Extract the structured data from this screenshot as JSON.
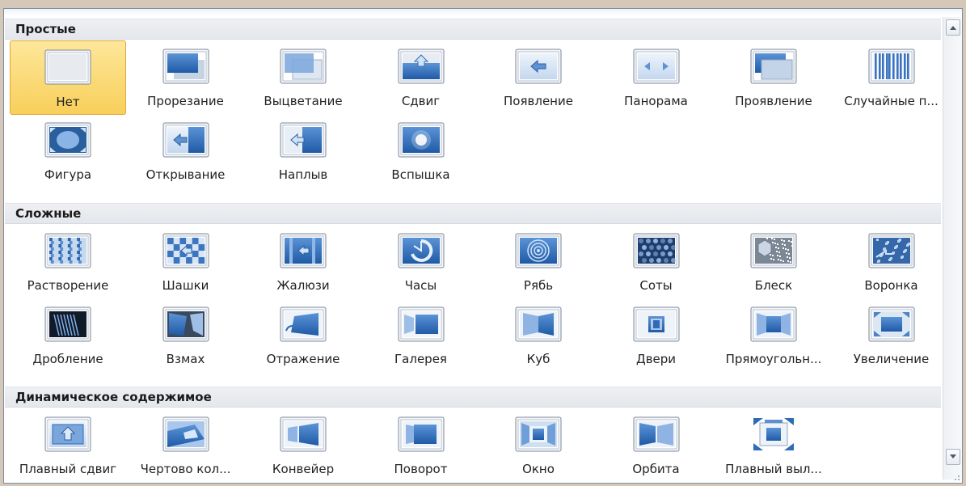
{
  "sections": [
    {
      "title": "Простые",
      "items": [
        {
          "label": "Нет",
          "icon": "none-icon",
          "selected": true
        },
        {
          "label": "Прорезание",
          "icon": "cut-icon"
        },
        {
          "label": "Выцветание",
          "icon": "fade-icon"
        },
        {
          "label": "Сдвиг",
          "icon": "push-icon"
        },
        {
          "label": "Появление",
          "icon": "wipe-icon"
        },
        {
          "label": "Панорама",
          "icon": "split-icon"
        },
        {
          "label": "Проявление",
          "icon": "reveal-icon"
        },
        {
          "label": "Случайные п...",
          "icon": "random-bars-icon"
        },
        {
          "label": "Фигура",
          "icon": "shape-icon"
        },
        {
          "label": "Открывание",
          "icon": "uncover-icon"
        },
        {
          "label": "Наплыв",
          "icon": "cover-icon"
        },
        {
          "label": "Вспышка",
          "icon": "flash-icon"
        }
      ]
    },
    {
      "title": "Сложные",
      "items": [
        {
          "label": "Растворение",
          "icon": "dissolve-icon"
        },
        {
          "label": "Шашки",
          "icon": "checkerboard-icon"
        },
        {
          "label": "Жалюзи",
          "icon": "blinds-icon"
        },
        {
          "label": "Часы",
          "icon": "clock-icon"
        },
        {
          "label": "Рябь",
          "icon": "ripple-icon"
        },
        {
          "label": "Соты",
          "icon": "honeycomb-icon"
        },
        {
          "label": "Блеск",
          "icon": "glitter-icon"
        },
        {
          "label": "Воронка",
          "icon": "vortex-icon"
        },
        {
          "label": "Дробление",
          "icon": "shred-icon"
        },
        {
          "label": "Взмах",
          "icon": "switch-icon"
        },
        {
          "label": "Отражение",
          "icon": "flip-icon"
        },
        {
          "label": "Галерея",
          "icon": "gallery-icon"
        },
        {
          "label": "Куб",
          "icon": "cube-icon"
        },
        {
          "label": "Двери",
          "icon": "doors-icon"
        },
        {
          "label": "Прямоугольн...",
          "icon": "box-icon"
        },
        {
          "label": "Увеличение",
          "icon": "zoom-icon"
        }
      ]
    },
    {
      "title": "Динамическое содержимое",
      "items": [
        {
          "label": "Плавный сдвиг",
          "icon": "pan-icon"
        },
        {
          "label": "Чертово кол...",
          "icon": "ferris-wheel-icon"
        },
        {
          "label": "Конвейер",
          "icon": "conveyor-icon"
        },
        {
          "label": "Поворот",
          "icon": "rotate-icon"
        },
        {
          "label": "Окно",
          "icon": "window-icon"
        },
        {
          "label": "Орбита",
          "icon": "orbit-icon"
        },
        {
          "label": "Плавный выл...",
          "icon": "fly-through-icon"
        }
      ]
    }
  ],
  "colors": {
    "selected_fill": "#f8cf5a",
    "icon_blue": "#2e6bb8",
    "icon_light": "#cfe0f4"
  }
}
